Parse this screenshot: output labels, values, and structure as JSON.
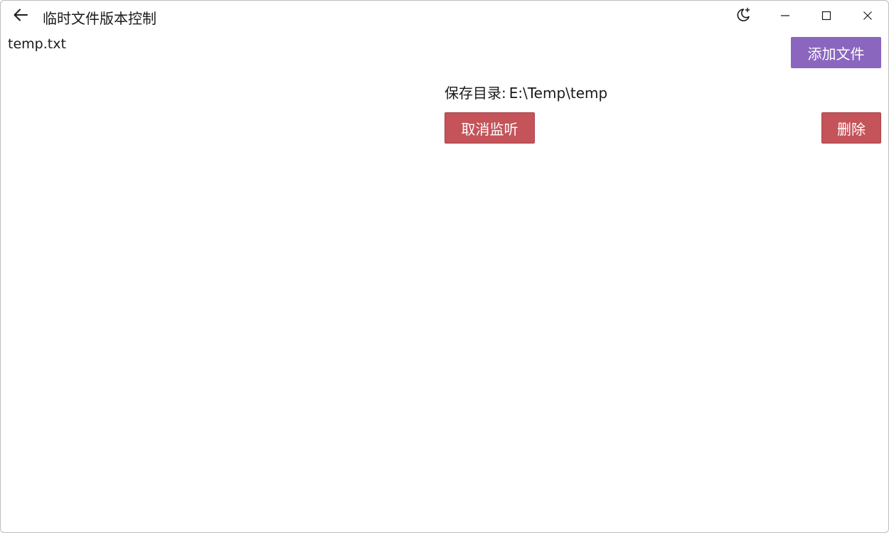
{
  "window": {
    "title": "临时文件版本控制",
    "icons": {
      "back": "arrow-left-icon",
      "theme": "moon-sparkle-icon",
      "minimize": "minimize-icon",
      "maximize": "maximize-icon",
      "close": "close-icon"
    }
  },
  "files": [
    {
      "name": "temp.txt"
    }
  ],
  "toolbar": {
    "add_file_label": "添加文件"
  },
  "detail": {
    "save_dir_label": "保存目录:",
    "save_dir_value": "E:\\Temp\\temp",
    "cancel_watch_label": "取消监听",
    "delete_label": "删除"
  },
  "colors": {
    "accent_purple": "#8a66bf",
    "danger_red": "#c4545a"
  }
}
